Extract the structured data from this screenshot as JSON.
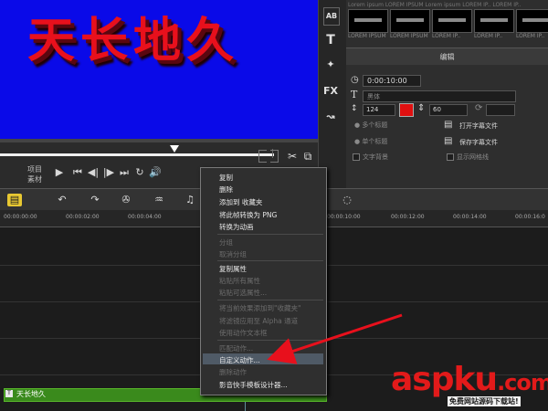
{
  "preview": {
    "title": "天长地久"
  },
  "player": {
    "mode_project": "项目",
    "mode_clip": "素材",
    "play": "▶",
    "prev": "⏮",
    "step_back": "◀|",
    "step_fwd": "|▶",
    "next": "⏭",
    "loop": "↻",
    "volume": "🔊",
    "trim_icon": "✂",
    "copy_icon": "⧉"
  },
  "right_panel": {
    "strip_icons": [
      "AB",
      "T",
      "✦",
      "FX",
      "↝"
    ],
    "thumb_labels": [
      "LOREM IPSUM",
      "LOREM IPSUM",
      "LOREM IP..",
      "LOREM IP..",
      "LOREM IP.."
    ],
    "thumb_top": "Lorem ipsum  LOREM IPSUM  Lorem ipsum  LOREM IP..  LOREM IP..",
    "tab_edit": "编辑",
    "timecode": "0:00:10:00",
    "font_placeholder": "黑体",
    "font_size": "124",
    "line_spacing": "60",
    "text_color": "#e01010",
    "opt_single": "多个标题",
    "opt_multi": "单个标题",
    "open_subtitle": "打开字幕文件",
    "save_subtitle": "保存字幕文件",
    "text_bg": "文字背景",
    "show_grid": "显示网格线"
  },
  "timeline": {
    "timecodes": [
      "00:00:00:00",
      "00:00:02:00",
      "00:00:04:00",
      "00:00:10:00",
      "00:00:12:00",
      "00:00:14:00",
      "00:00:16:0"
    ],
    "clip_label": "天长地久",
    "clip_icon": "T"
  },
  "context_menu": {
    "items": [
      {
        "label": "复制",
        "enabled": true
      },
      {
        "label": "删除",
        "enabled": true
      },
      {
        "label": "添加到 收藏夹",
        "enabled": true
      },
      {
        "label": "将此帧转换为 PNG",
        "enabled": true
      },
      {
        "label": "转换为动画",
        "enabled": true
      },
      {
        "label": "分组",
        "enabled": false
      },
      {
        "label": "取消分组",
        "enabled": false
      },
      {
        "label": "复制属性",
        "enabled": true
      },
      {
        "label": "粘贴所有属性",
        "enabled": false
      },
      {
        "label": "粘贴可选属性...",
        "enabled": false
      },
      {
        "label": "将当前效果添加到\"收藏夹\"",
        "enabled": false
      },
      {
        "label": "将滤镜应用至 Alpha 通道",
        "enabled": false
      },
      {
        "label": "使用动作文本框",
        "enabled": false
      },
      {
        "label": "匹配动作...",
        "enabled": false
      },
      {
        "label": "自定义动作...",
        "enabled": true,
        "highlighted": true
      },
      {
        "label": "删除动作",
        "enabled": false
      },
      {
        "label": "影音快手模板设计器...",
        "enabled": true
      }
    ]
  },
  "watermark": {
    "main": "aspku",
    "dot": ".com",
    "sub": "免费网站源码下载站!"
  }
}
